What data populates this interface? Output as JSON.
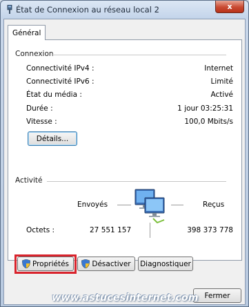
{
  "window": {
    "title": "État de Connexion au réseau local 2",
    "close_label": "x"
  },
  "tabs": [
    {
      "label": "Général"
    }
  ],
  "connexion": {
    "title": "Connexion",
    "rows": [
      {
        "label": "Connectivité IPv4 :",
        "value": "Internet"
      },
      {
        "label": "Connectivité IPv6 :",
        "value": "Limité"
      },
      {
        "label": "État du média :",
        "value": "Activé"
      },
      {
        "label": "Durée :",
        "value": "1 jour 03:25:31"
      },
      {
        "label": "Vitesse :",
        "value": "100,0 Mbits/s"
      }
    ],
    "details_button": "Détails..."
  },
  "activite": {
    "title": "Activité",
    "sent_label": "Envoyés",
    "received_label": "Reçus",
    "bytes_label": "Octets :",
    "bytes_sent": "27 551 157",
    "bytes_received": "398 373 778"
  },
  "buttons": {
    "properties": "Propriétés",
    "disable": "Désactiver",
    "diagnose": "Diagnostiquer",
    "close": "Fermer"
  },
  "watermark": "www.astucesinternet.com",
  "colors": {
    "highlight": "#d9232c",
    "panel_bg": "#ffffff",
    "dialog_bg": "#f0f0f0"
  }
}
